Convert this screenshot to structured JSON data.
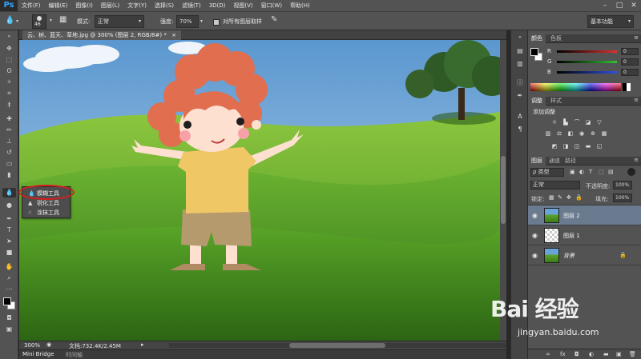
{
  "app": {
    "logo": "Ps",
    "menu": [
      "文件(F)",
      "编辑(E)",
      "图像(I)",
      "图层(L)",
      "文字(Y)",
      "选择(S)",
      "滤镜(T)",
      "3D(D)",
      "视图(V)",
      "窗口(W)",
      "帮助(H)"
    ],
    "window_buttons": [
      "–",
      "□",
      "✕"
    ]
  },
  "options": {
    "brush_size": "46",
    "mode_label": "模式:",
    "mode_value": "正常",
    "strength_label": "强度:",
    "strength_value": "70%",
    "sample_all_label": "对所有图层取样",
    "workspace": "基本功能"
  },
  "document": {
    "tab_title": "云、树、蓝天、草地.jpg @ 300% (图层 2, RGB/8#) *",
    "tab_close": "×"
  },
  "status": {
    "zoom": "300%",
    "doc_info": "文档:732.4K/2.45M"
  },
  "bottom_tabs": [
    "Mini Bridge",
    "时间轴"
  ],
  "flyout": {
    "items": [
      {
        "label": "模糊工具",
        "icon": "blur-icon"
      },
      {
        "label": "锐化工具",
        "icon": "sharpen-icon"
      },
      {
        "label": "涂抹工具",
        "icon": "smudge-icon"
      }
    ]
  },
  "color_panel": {
    "tabs": [
      "颜色",
      "色板"
    ],
    "channels": [
      {
        "name": "R",
        "value": "0",
        "color": "#e03030"
      },
      {
        "name": "G",
        "value": "0",
        "color": "#30c030"
      },
      {
        "name": "B",
        "value": "0",
        "color": "#3050e0"
      }
    ]
  },
  "adjust_panel": {
    "tabs": [
      "调整",
      "样式"
    ],
    "title": "添加调整"
  },
  "layers_panel": {
    "tabs": [
      "图层",
      "通道",
      "路径"
    ],
    "filter_label": "ρ 类型",
    "blend_mode": "正常",
    "opacity_label": "不透明度:",
    "opacity_value": "100%",
    "lock_label": "锁定:",
    "fill_label": "填充:",
    "fill_value": "100%",
    "layers": [
      {
        "name": "图层 2",
        "selected": true
      },
      {
        "name": "图层 1",
        "selected": false
      },
      {
        "name": "背景",
        "selected": false,
        "locked": true
      }
    ],
    "footer_icons": [
      "link-icon",
      "fx-icon",
      "mask-icon",
      "adjustment-icon",
      "folder-icon",
      "new-layer-icon",
      "trash-icon"
    ]
  },
  "watermark": {
    "logo_text": "Bai 经验",
    "url": "jingyan.baidu.com"
  },
  "colors": {
    "accent": "#31a8ff",
    "highlight_ring": "#d41e1e",
    "selected_layer": "#6a7a8f"
  }
}
